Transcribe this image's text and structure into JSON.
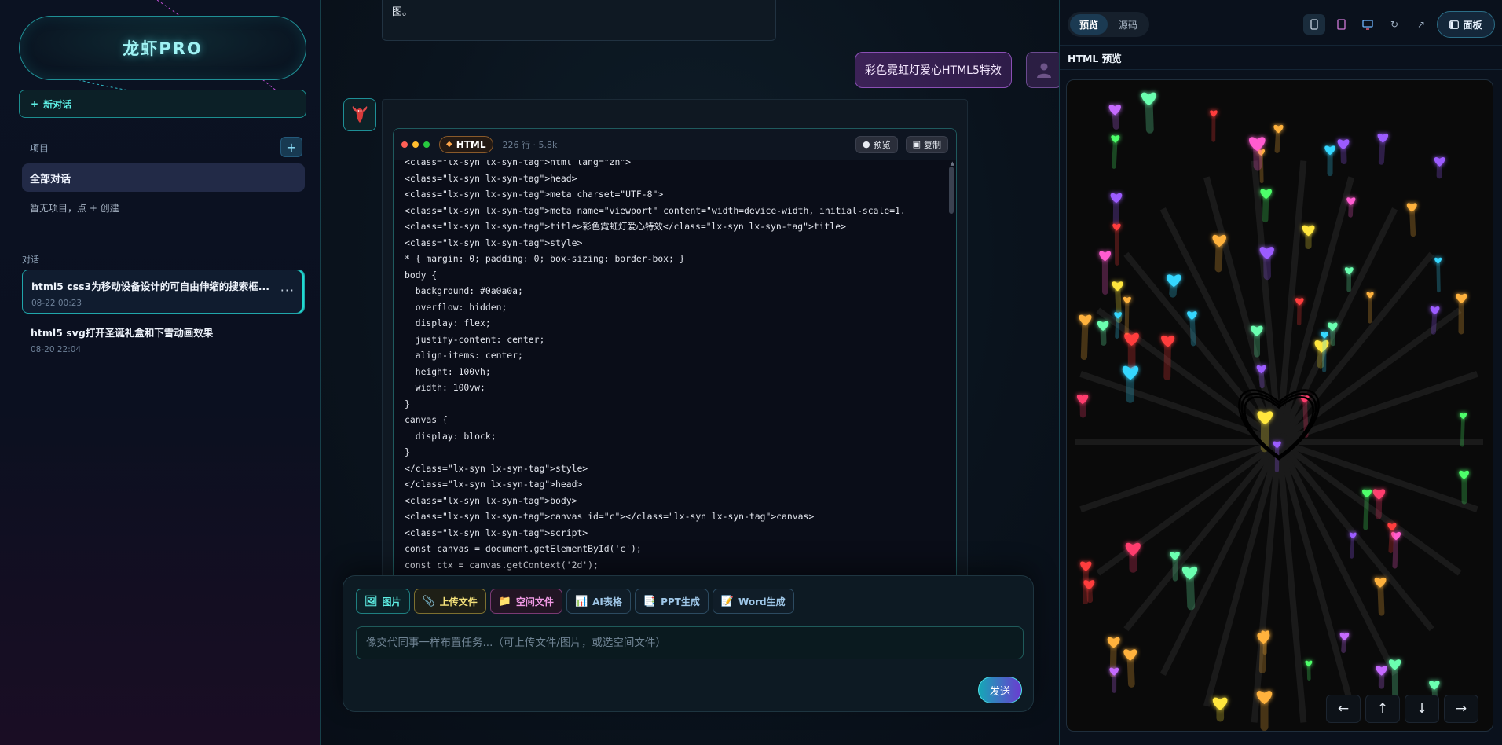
{
  "sidebar": {
    "logo": "龙虾PRO",
    "new_chat": "新对话",
    "new_chat_prefix": "+",
    "projects_label": "项目",
    "add_project": "+",
    "all_chats": "全部对话",
    "no_projects": "暂无项目，点 + 创建",
    "chats_label": "对话",
    "conversations": [
      {
        "title": "html5 css3为移动设备设计的可自由伸缩的搜索框...",
        "time": "08-22 00:23",
        "more": "···"
      },
      {
        "title": "html5 svg打开圣诞礼盒和下雪动画效果",
        "time": "08-20 22:04"
      }
    ]
  },
  "chat": {
    "prev_tail": "图。",
    "user_message": "彩色霓虹灯爱心HTML5特效",
    "code_block": {
      "lang": "HTML",
      "meta": "226 行 · 5.8k",
      "preview_label": "预览",
      "copy_label": "复制",
      "lines": [
        "<class=\"lx-syn lx-syn-tag\">html lang=\"zh\">",
        "<class=\"lx-syn lx-syn-tag\">head>",
        "<class=\"lx-syn lx-syn-tag\">meta charset=\"UTF-8\">",
        "<class=\"lx-syn lx-syn-tag\">meta name=\"viewport\" content=\"width=device-width, initial-scale=1.",
        "<class=\"lx-syn lx-syn-tag\">title>彩色霓虹灯爱心特效</class=\"lx-syn lx-syn-tag\">title>",
        "<class=\"lx-syn lx-syn-tag\">style>",
        "* { margin: 0; padding: 0; box-sizing: border-box; }",
        "body {",
        "  background: #0a0a0a;",
        "  overflow: hidden;",
        "  display: flex;",
        "  justify-content: center;",
        "  align-items: center;",
        "  height: 100vh;",
        "  width: 100vw;",
        "}",
        "canvas {",
        "  display: block;",
        "}",
        "</class=\"lx-syn lx-syn-tag\">style>",
        "</class=\"lx-syn lx-syn-tag\">head>",
        "<class=\"lx-syn lx-syn-tag\">body>",
        "<class=\"lx-syn lx-syn-tag\">canvas id=\"c\"></class=\"lx-syn lx-syn-tag\">canvas>",
        "<class=\"lx-syn lx-syn-tag\">script>",
        "const canvas = document.getElementById('c');",
        "const ctx = canvas.getContext('2d');"
      ]
    },
    "composer": {
      "tools": [
        {
          "label": "图片",
          "icon": "image-icon",
          "glyph": "🖼",
          "color": "#5ef0e6",
          "border": "#1f7f80",
          "bg": "#0c2127"
        },
        {
          "label": "上传文件",
          "icon": "paperclip-icon",
          "glyph": "📎",
          "color": "#f5e27a",
          "border": "#7d7030",
          "bg": "#1e1f16"
        },
        {
          "label": "空间文件",
          "icon": "folder-icon",
          "glyph": "📁",
          "color": "#f29ae6",
          "border": "#7b3a74",
          "bg": "#221524"
        },
        {
          "label": "AI表格",
          "icon": "chart-icon",
          "glyph": "📊",
          "color": "#9fc7e8",
          "border": "#2c4a60",
          "bg": "#101d28"
        },
        {
          "label": "PPT生成",
          "icon": "ppt-icon",
          "glyph": "📑",
          "color": "#9fc7e8",
          "border": "#2c4a60",
          "bg": "#101d28"
        },
        {
          "label": "Word生成",
          "icon": "word-icon",
          "glyph": "📝",
          "color": "#9fc7e8",
          "border": "#2c4a60",
          "bg": "#101d28"
        }
      ],
      "placeholder": "像交代同事一样布置任务...（可上传文件/图片，或选空间文件）",
      "send": "发送"
    }
  },
  "panel": {
    "tab_preview": "预览",
    "tab_source": "源码",
    "panel_button": "面板",
    "title": "HTML 预览",
    "toolbar_icons": [
      "mobile-icon",
      "tablet-icon",
      "desktop-icon",
      "refresh-icon",
      "open-external-icon"
    ],
    "nav": {
      "left": "←",
      "up": "↑",
      "down": "↓",
      "right": "→"
    }
  }
}
